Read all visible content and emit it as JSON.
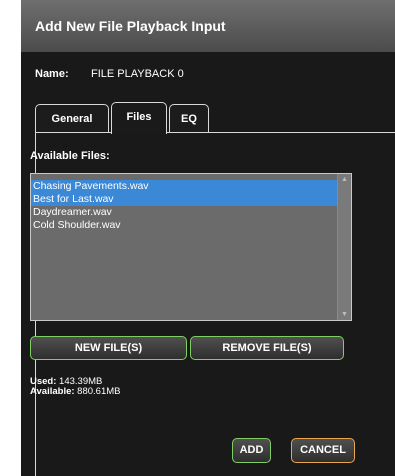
{
  "dialog": {
    "title": "Add New File Playback Input",
    "name_label": "Name:",
    "name_value": "FILE PLAYBACK 0"
  },
  "tabs": [
    {
      "label": "General",
      "active": false
    },
    {
      "label": "Files",
      "active": true
    },
    {
      "label": "EQ",
      "active": false
    }
  ],
  "files": {
    "available_label": "Available Files:",
    "items": [
      {
        "name": "Chasing Pavements.wav",
        "selected": true
      },
      {
        "name": "Best for Last.wav",
        "selected": true
      },
      {
        "name": "Daydreamer.wav",
        "selected": false
      },
      {
        "name": "Cold Shoulder.wav",
        "selected": false
      }
    ],
    "new_button": "NEW FILE(S)",
    "remove_button": "REMOVE FILE(S)"
  },
  "usage": {
    "used_label": "Used:",
    "used_value": "143.39MB",
    "available_label": "Available:",
    "available_value": "880.61MB"
  },
  "actions": {
    "add": "ADD",
    "cancel": "CANCEL"
  },
  "colors": {
    "selection": "#3a88d6",
    "accent_green": "#7fcf63",
    "accent_orange": "#e9a64e"
  }
}
